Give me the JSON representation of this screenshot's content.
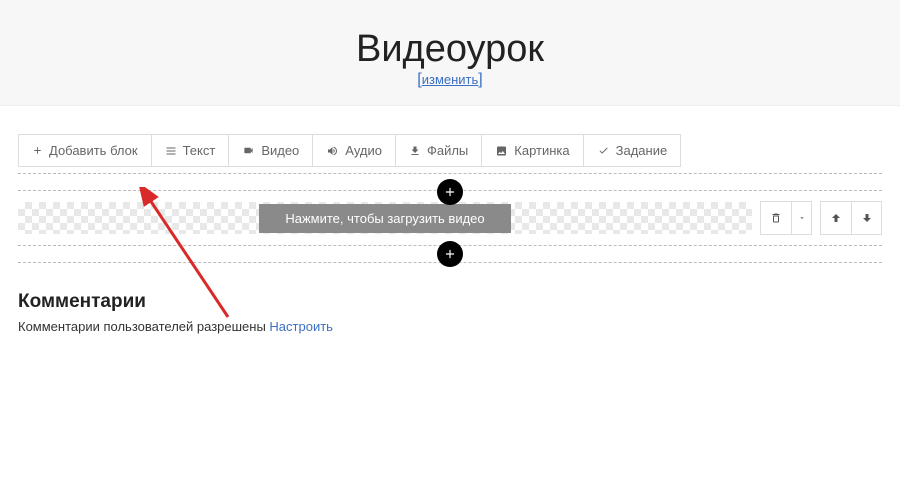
{
  "header": {
    "title": "Видеоурок",
    "edit_label": "изменить"
  },
  "toolbar": {
    "add_block": "Добавить блок",
    "text": "Текст",
    "video": "Видео",
    "audio": "Аудио",
    "files": "Файлы",
    "image": "Картинка",
    "task": "Задание"
  },
  "block": {
    "upload_video_label": "Нажмите, чтобы загрузить видео"
  },
  "comments": {
    "heading": "Комментарии",
    "status_text": "Комментарии пользователей разрешены ",
    "configure_label": "Настроить"
  },
  "icons": {
    "plus": "plus-icon",
    "text": "align-justify-icon",
    "video": "video-camera-icon",
    "audio": "volume-icon",
    "files": "download-icon",
    "image": "image-icon",
    "task": "check-icon",
    "trash": "trash-icon",
    "caret": "caret-down-icon",
    "arrow_up": "arrow-up-icon",
    "arrow_down": "arrow-down-icon"
  }
}
